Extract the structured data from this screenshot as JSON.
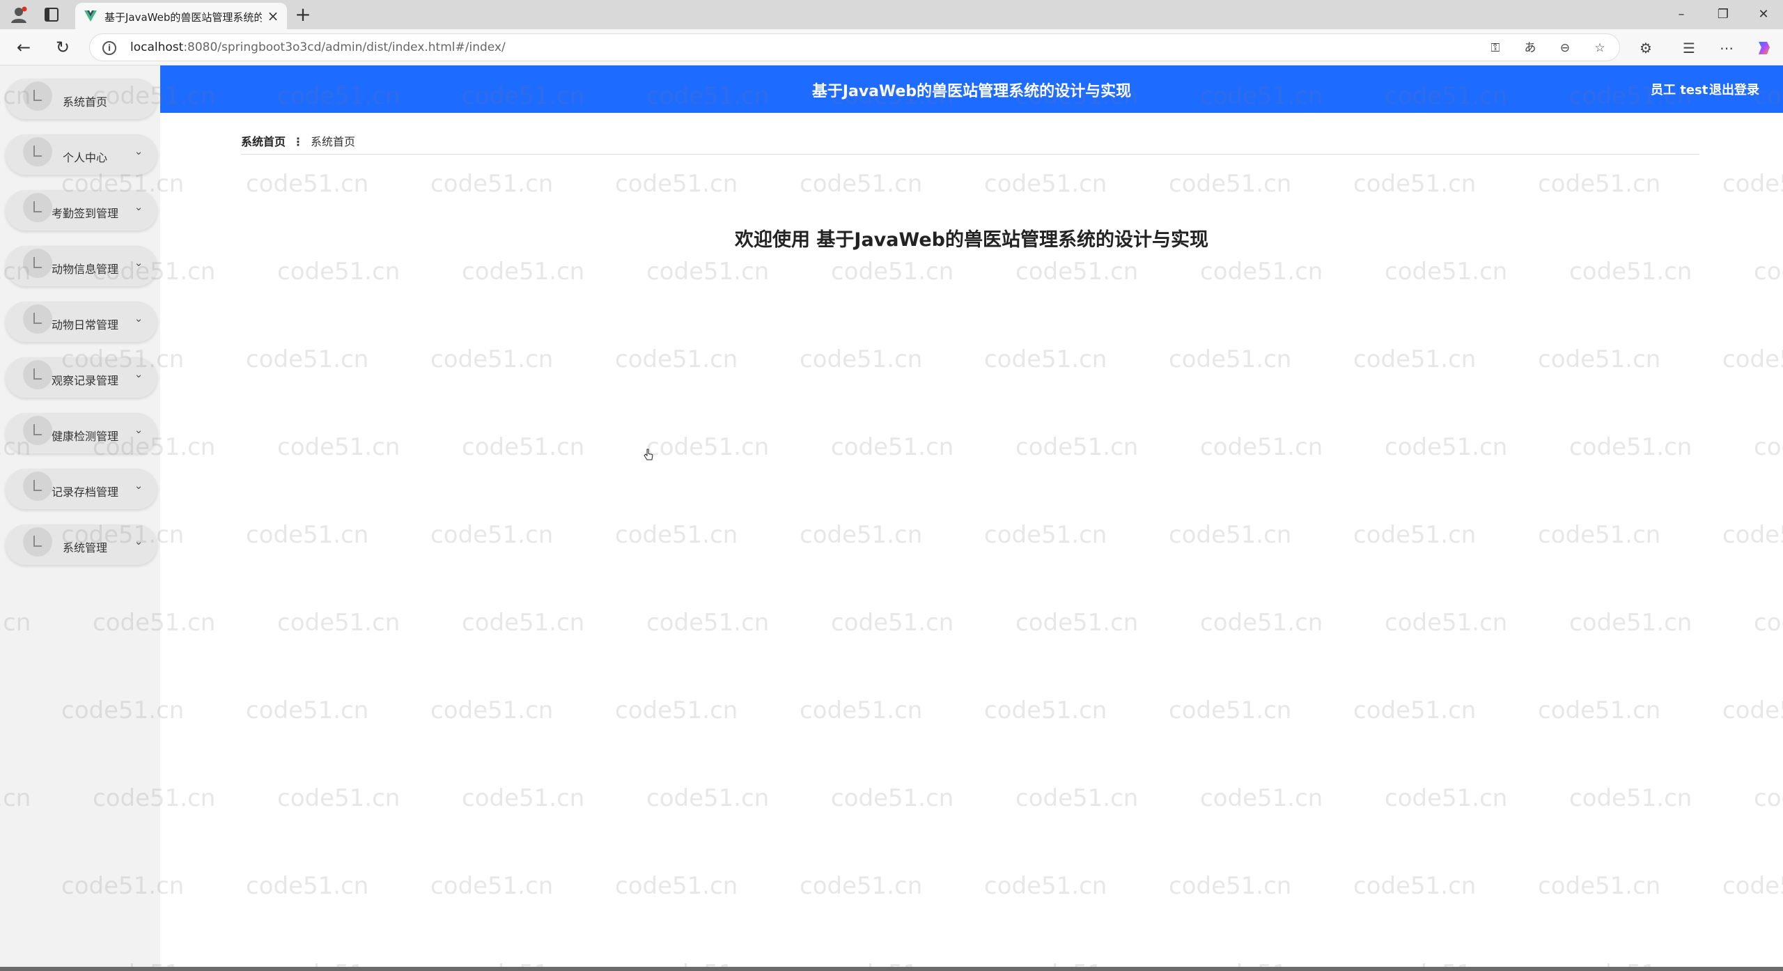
{
  "browser": {
    "tab_title": "基于JavaWeb的兽医站管理系统的",
    "url_host": "localhost",
    "url_rest": ":8080/springboot3o3cd/admin/dist/index.html#/index/"
  },
  "app": {
    "header_title": "基于JavaWeb的兽医站管理系统的设计与实现",
    "user_label": "员工 test",
    "logout_label": "退出登录",
    "breadcrumb": {
      "home": "系统首页",
      "current": "系统首页"
    },
    "welcome": "欢迎使用 基于JavaWeb的兽医站管理系统的设计与实现",
    "watermark_text": "code51.cn",
    "accent_color": "#1e6bff"
  },
  "sidebar": {
    "items": [
      {
        "label": "系统首页",
        "has_children": false
      },
      {
        "label": "个人中心",
        "has_children": true
      },
      {
        "label": "考勤签到管理",
        "has_children": true
      },
      {
        "label": "动物信息管理",
        "has_children": true
      },
      {
        "label": "动物日常管理",
        "has_children": true
      },
      {
        "label": "观察记录管理",
        "has_children": true
      },
      {
        "label": "健康检测管理",
        "has_children": true
      },
      {
        "label": "记录存档管理",
        "has_children": true
      },
      {
        "label": "系统管理",
        "has_children": true
      }
    ]
  }
}
